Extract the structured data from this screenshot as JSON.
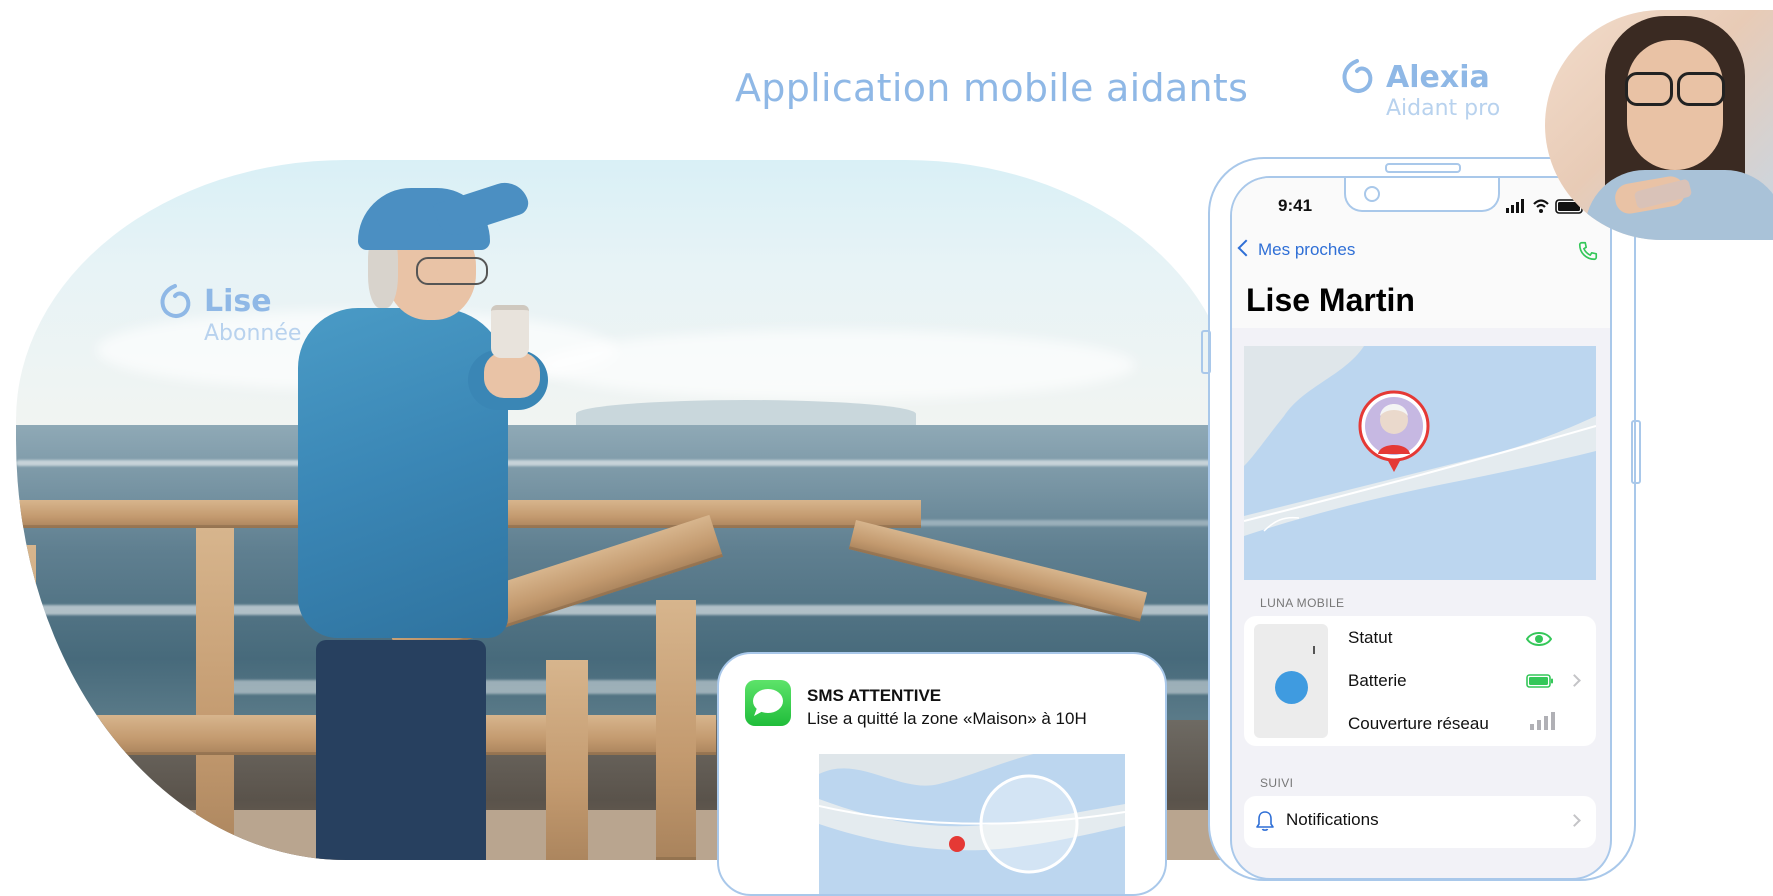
{
  "header": {
    "title": "Application mobile aidants"
  },
  "caregiver": {
    "name": "Alexia",
    "role": "Aidant pro"
  },
  "subscriber": {
    "name": "Lise",
    "role": "Abonnée"
  },
  "phone": {
    "status_time": "9:41",
    "back_label": "Mes proches",
    "contact_name": "Lise Martin",
    "sections": {
      "device_header": "LUNA MOBILE",
      "device_rows": [
        {
          "label": "Statut",
          "icon": "eye-icon"
        },
        {
          "label": "Batterie",
          "icon": "battery-icon"
        },
        {
          "label": "Couverture réseau",
          "icon": "signal-icon"
        }
      ],
      "follow_header": "SUIVI",
      "follow_rows": [
        {
          "label": "Notifications",
          "icon": "bell-icon"
        }
      ]
    }
  },
  "sms": {
    "title": "SMS ATTENTIVE",
    "body": "Lise  a quitté la zone «Maison» à 10H"
  },
  "colors": {
    "brand": "#8fb8e6",
    "ios_blue": "#2f6fd6",
    "status_green": "#34c759",
    "alert_red": "#e53935"
  }
}
